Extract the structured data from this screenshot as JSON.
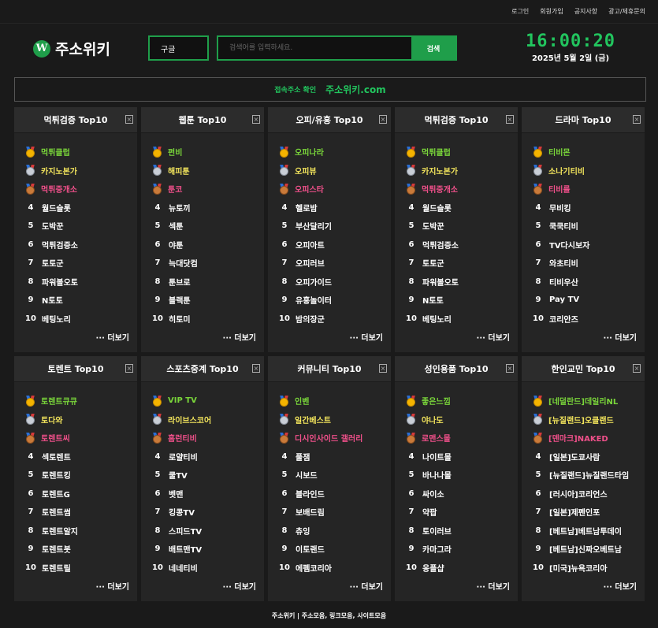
{
  "topnav": [
    "로그인",
    "회원가입",
    "공지사항",
    "광고/제휴문의"
  ],
  "logo": {
    "mark": "W",
    "text": "주소위키"
  },
  "search": {
    "engine": "구글",
    "placeholder": "검색어를 입력하세요.",
    "button": "검색"
  },
  "clock": {
    "time": "16:00:20",
    "date": "2025년 5월 2일 (금)"
  },
  "banner": {
    "label": "접속주소 확인",
    "domain": "주소위키.com"
  },
  "more_label": "··· 더보기",
  "close_glyph": "×",
  "colors": {
    "accent": "#1f9e4a",
    "rank1": "#7ad63a",
    "rank2": "#f2e45c",
    "rank3": "#f0508a"
  },
  "panels": [
    {
      "title": "먹튀검증 Top10",
      "items": [
        "먹튀클럽",
        "카지노본가",
        "먹튀중개소",
        "월드슬롯",
        "도박꾼",
        "먹튀검증소",
        "토토군",
        "파워볼오토",
        "N토토",
        "베팅노리"
      ]
    },
    {
      "title": "웹툰 Top10",
      "items": [
        "펀비",
        "해피툰",
        "툰코",
        "뉴토끼",
        "섹툰",
        "야툰",
        "늑대닷컴",
        "툰브로",
        "블랙툰",
        "히토미"
      ]
    },
    {
      "title": "오피/유흥 Top10",
      "items": [
        "오피나라",
        "오피뷰",
        "오피스타",
        "헬로밤",
        "부산달리기",
        "오피아트",
        "오피러브",
        "오피가이드",
        "유흥놀이터",
        "밤의장군"
      ]
    },
    {
      "title": "먹튀검증 Top10",
      "items": [
        "먹튀클럽",
        "카지노본가",
        "먹튀중개소",
        "월드슬롯",
        "도박꾼",
        "먹튀검증소",
        "토토군",
        "파워볼오토",
        "N토토",
        "베팅노리"
      ]
    },
    {
      "title": "드라마 Top10",
      "items": [
        "티비몬",
        "소나기티비",
        "티비룰",
        "무비킹",
        "쿡쿡티비",
        "TV다시보자",
        "와초티비",
        "티비우산",
        "Pay TV",
        "코리안즈"
      ]
    },
    {
      "title": "토렌트 Top10",
      "items": [
        "토렌트큐큐",
        "토다와",
        "토렌트씨",
        "섹토렌트",
        "토렌트킹",
        "토렌트G",
        "토렌트썸",
        "토렌트알지",
        "토렌트봇",
        "토렌트릴"
      ]
    },
    {
      "title": "스포츠중계 Top10",
      "items": [
        "VIP TV",
        "라이브스코어",
        "홈런티비",
        "로얄티비",
        "쿨TV",
        "벳맨",
        "킹콩TV",
        "스피드TV",
        "배트맨TV",
        "네네티비"
      ]
    },
    {
      "title": "커뮤니티 Top10",
      "items": [
        "인벤",
        "일간베스트",
        "디시인사이드 갤러리",
        "풀잼",
        "시보드",
        "블라인드",
        "보배드림",
        "츄잉",
        "이토랜드",
        "에펨코리아"
      ]
    },
    {
      "title": "성인용품 Top10",
      "items": [
        "좋은느낌",
        "야나도",
        "로맨스몰",
        "나이트몰",
        "바나나몰",
        "싸이소",
        "약팝",
        "토이러브",
        "카마그라",
        "옹플샵"
      ]
    },
    {
      "title": "한인교민 Top10",
      "items": [
        "[네덜란드]데일리NL",
        "[뉴질랜드]오클랜드",
        "[덴마크]NAKED",
        "[일본]도쿄사람",
        "[뉴질랜드]뉴질랜드타임",
        "[러시아]코리언스",
        "[일본]제펜인포",
        "[베트남]베트남투데이",
        "[베트남]신짜오베트남",
        "[미국]뉴욕코리아"
      ]
    }
  ],
  "footer": "주소위키 | 주소모음, 링크모음, 사이트모음"
}
